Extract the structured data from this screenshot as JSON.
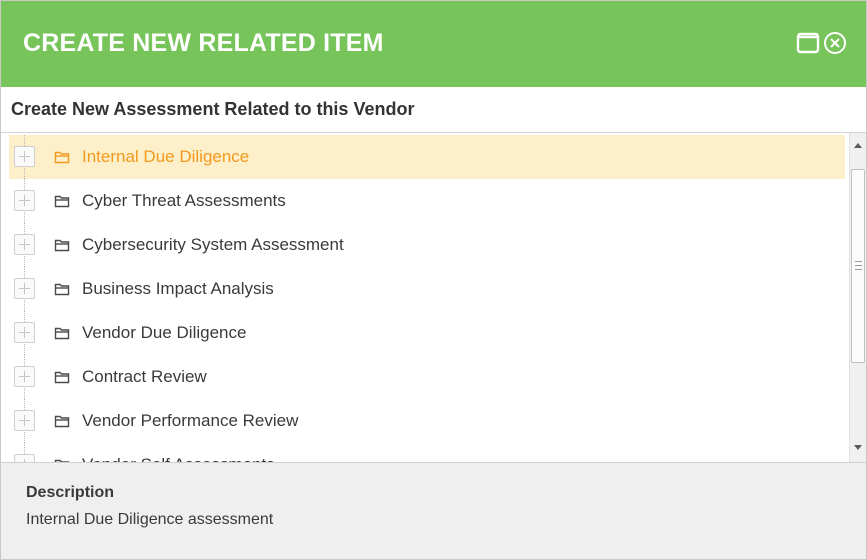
{
  "dialog": {
    "title": "CREATE NEW RELATED ITEM",
    "subtitle": "Create New Assessment Related to this Vendor",
    "accent_color": "#76c45a",
    "selected_color": "#f29a1e",
    "selected_bg": "#fdefc9"
  },
  "title_buttons": [
    {
      "icon": "maximize-icon"
    },
    {
      "icon": "close-circle-icon"
    }
  ],
  "tree": {
    "items": [
      {
        "label": "Internal Due Diligence",
        "selected": true,
        "icon": "folder-icon"
      },
      {
        "label": "Cyber Threat Assessments",
        "selected": false,
        "icon": "folder-icon"
      },
      {
        "label": "Cybersecurity System Assessment",
        "selected": false,
        "icon": "folder-icon"
      },
      {
        "label": "Business Impact Analysis",
        "selected": false,
        "icon": "folder-icon"
      },
      {
        "label": "Vendor Due Diligence",
        "selected": false,
        "icon": "folder-icon"
      },
      {
        "label": "Contract Review",
        "selected": false,
        "icon": "folder-icon"
      },
      {
        "label": "Vendor Performance Review",
        "selected": false,
        "icon": "folder-icon"
      },
      {
        "label": "Vendor Self Assessments",
        "selected": false,
        "icon": "folder-icon"
      }
    ]
  },
  "description": {
    "title": "Description",
    "text": "Internal Due Diligence assessment"
  }
}
